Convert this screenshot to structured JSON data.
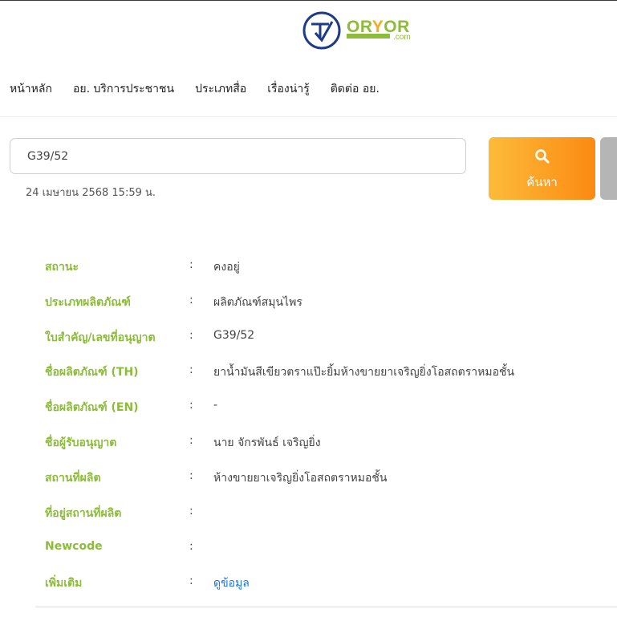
{
  "logo": {
    "text_a": "OR",
    "text_y": "Y",
    "text_b": "OR",
    "suffix": ".com"
  },
  "nav": [
    "หน้าหลัก",
    "อย. บริการประชาชน",
    "ประเภทสื่อ",
    "เรื่องน่ารู้",
    "ติดต่อ อย."
  ],
  "search": {
    "value": "G39/52",
    "date": "24 เมษายน 2568 15:59 น.",
    "button_label": "ค้นหา"
  },
  "colon": ":",
  "details": [
    {
      "label": "สถานะ",
      "value": "คงอยู่"
    },
    {
      "label": "ประเภทผลิตภัณฑ์",
      "value": "ผลิตภัณฑ์สมุนไพร"
    },
    {
      "label": "ใบสำคัญ/เลขที่อนุญาต",
      "value": "G39/52"
    },
    {
      "label": "ชื่อผลิตภัณฑ์ (TH)",
      "value": "ยาน้ำมันสีเขียวตราแป๊ะยิ้มห้างขายยาเจริญยิ่งโอสถตราหมอชั้น"
    },
    {
      "label": "ชื่อผลิตภัณฑ์ (EN)",
      "value": "-"
    },
    {
      "label": "ชื่อผู้รับอนุญาต",
      "value": "นาย จักรพันธ์ เจริญยิ่ง"
    },
    {
      "label": "สถานที่ผลิต",
      "value": "ห้างขายยาเจริญยิ่งโอสถตราหมอชั้น"
    },
    {
      "label": "ที่อยู่สถานที่ผลิต",
      "value": ""
    },
    {
      "label": "Newcode",
      "value": ""
    },
    {
      "label": "เพิ่มเติม",
      "value": "ดูข้อมูล"
    }
  ],
  "colors": {
    "brand_green": "#8cbc3a",
    "orange": "#fb8a12",
    "link": "#1a73e8"
  }
}
